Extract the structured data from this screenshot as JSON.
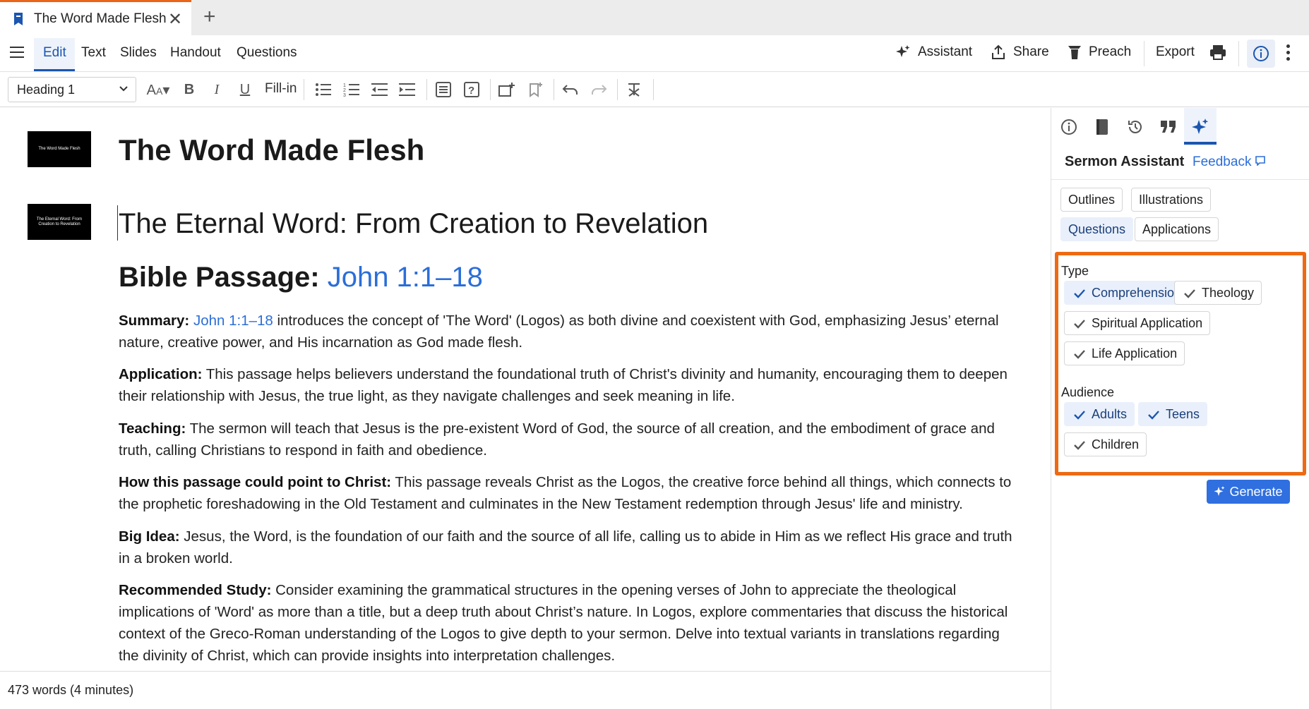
{
  "tab": {
    "title": "The Word Made Flesh"
  },
  "menu": {
    "items": [
      "Edit",
      "Text",
      "Slides",
      "Handout",
      "Questions"
    ],
    "actions": {
      "assistant": "Assistant",
      "share": "Share",
      "preach": "Preach",
      "export": "Export"
    }
  },
  "toolbar": {
    "style_value": "Heading 1",
    "fillin": "Fill-in"
  },
  "document": {
    "title": "The Word Made Flesh",
    "thumb1": "The Word Made Flesh",
    "thumb2": "The Eternal Word: From Creation to Revelation",
    "sermon_title": "The Eternal Word: From Creation to Revelation",
    "passage_label": "Bible Passage:",
    "passage_ref": "John 1:1–18",
    "summary_label": "Summary:",
    "summary_ref": "John 1:1–18",
    "summary_text": " introduces the concept of 'The Word' (Logos) as both divine and coexistent with God, emphasizing Jesus’ eternal nature, creative power, and His incarnation as God made flesh.",
    "application_label": "Application:",
    "application_text": " This passage helps believers understand the foundational truth of Christ's divinity and humanity, encouraging them to deepen their relationship with Jesus, the true light, as they navigate challenges and seek meaning in life.",
    "teaching_label": "Teaching:",
    "teaching_text": " The sermon will teach that Jesus is the pre-existent Word of God, the source of all creation, and the embodiment of grace and truth, calling Christians to respond in faith and obedience.",
    "christ_label": "How this passage could point to Christ:",
    "christ_text": " This passage reveals Christ as the Logos, the creative force behind all things, which connects to the prophetic foreshadowing in the Old Testament and culminates in the New Testament redemption through Jesus' life and ministry.",
    "bigidea_label": "Big Idea:",
    "bigidea_text": " Jesus, the Word, is the foundation of our faith and the source of all life, calling us to abide in Him as we reflect His grace and truth in a broken world.",
    "study_label": "Recommended Study:",
    "study_text": " Consider examining the grammatical structures in the opening verses of John to appreciate the theological implications of 'Word' as more than a title, but a deep truth about Christ’s nature. In Logos, explore commentaries that discuss the historical context of the Greco-Roman understanding of the Logos to give depth to your sermon. Delve into textual variants in translations regarding the divinity of Christ, which can provide insights into interpretation challenges."
  },
  "status": {
    "word_count": "473 words (4 minutes)"
  },
  "panel": {
    "title": "Sermon Assistant",
    "feedback": "Feedback",
    "categories": [
      "Outlines",
      "Illustrations",
      "Questions",
      "Applications"
    ],
    "type_label": "Type",
    "types": [
      "Comprehension",
      "Theology",
      "Spiritual Application",
      "Life Application"
    ],
    "audience_label": "Audience",
    "audiences": [
      "Adults",
      "Teens",
      "Children"
    ],
    "generate": "Generate"
  },
  "colors": {
    "accent": "#1b56b0",
    "link": "#2b6ed8",
    "highlight": "#ee6a12",
    "tab_top": "#e8651a",
    "primary_button": "#2f6fdf"
  }
}
